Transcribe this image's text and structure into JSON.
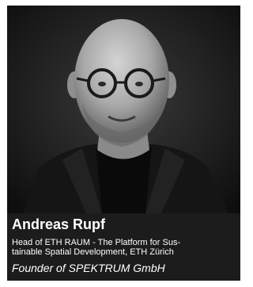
{
  "person": {
    "name": "Andreas Rupf",
    "role_line1": "Head of ETH RAUM - The Platform for Sus-",
    "role_line2": "tainable Spatial Development, ETH Zürich",
    "founder": "Founder of SPEKTRUM GmbH"
  }
}
